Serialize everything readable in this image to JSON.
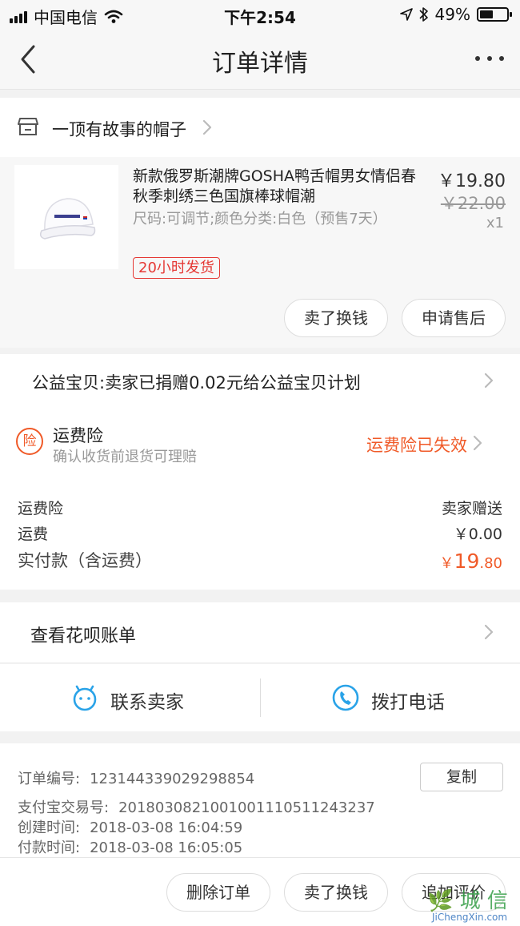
{
  "status_bar": {
    "carrier": "中国电信",
    "time": "下午2:54",
    "battery_percent": "49%",
    "battery_level": 0.49
  },
  "nav": {
    "title": "订单详情"
  },
  "shop": {
    "name": "一顶有故事的帽子"
  },
  "item": {
    "name": "新款俄罗斯潮牌GOSHA鸭舌帽男女情侣春秋季刺绣三色国旗棒球帽潮",
    "spec": "尺码:可调节;颜色分类:白色（预售7天）",
    "badge": "20小时发货",
    "price": "￥19.80",
    "old_price": "￥22.00",
    "quantity": "x1",
    "buttons": {
      "sell": "卖了换钱",
      "after_sale": "申请售后"
    }
  },
  "charity": {
    "text": "公益宝贝:卖家已捐赠0.02元给公益宝贝计划"
  },
  "insurance": {
    "icon_text": "险",
    "title": "运费险",
    "subtitle": "确认收货前退货可理赔",
    "status": "运费险已失效"
  },
  "fees": {
    "rows": [
      {
        "label": "运费险",
        "value": "卖家赠送"
      },
      {
        "label": "运费",
        "value": "￥0.00"
      }
    ],
    "total_label": "实付款（含运费）",
    "total_currency": "￥",
    "total_int": "19",
    "total_dec": ".80"
  },
  "huabei": {
    "text": "查看花呗账单"
  },
  "contact": {
    "seller": "联系卖家",
    "call": "拨打电话"
  },
  "order_info": {
    "order_no_label": "订单编号:",
    "order_no": "123144339029298854",
    "copy": "复制",
    "alipay_label": "支付宝交易号:",
    "alipay_no": "2018030821001001110511243237",
    "created_label": "创建时间:",
    "created": "2018-03-08 16:04:59",
    "paid_label": "付款时间:",
    "paid": "2018-03-08 16:05:05"
  },
  "footer": {
    "delete": "删除订单",
    "sell": "卖了换钱",
    "review": "追加评价"
  },
  "watermark": {
    "cn": "🌿 城 信",
    "en": "JiChengXin.com"
  },
  "colors": {
    "accent_orange": "#f05a28",
    "badge_red": "#e53935",
    "icon_blue": "#2aa3e8"
  }
}
